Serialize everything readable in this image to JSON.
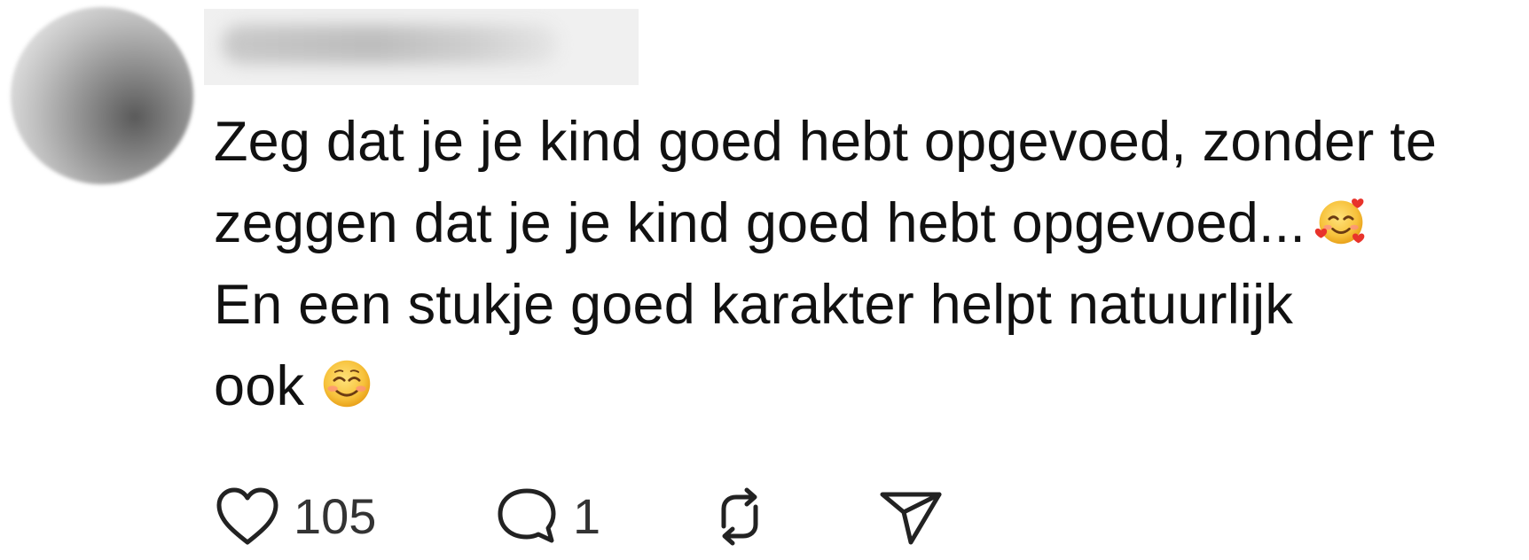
{
  "post": {
    "lines": [
      "Zeg dat je je kind goed hebt opgevoed, zonder te",
      "zeggen dat je je kind goed hebt opgevoed...",
      "En een stukje goed karakter helpt natuurlijk",
      "ook"
    ],
    "emojis": [
      "smiling-face-with-hearts",
      "smiling-face"
    ]
  },
  "actions": {
    "like_count": "105",
    "reply_count": "1"
  },
  "icons": {
    "like": "heart-icon",
    "reply": "speech-bubble-icon",
    "repost": "repost-icon",
    "share": "send-icon"
  }
}
